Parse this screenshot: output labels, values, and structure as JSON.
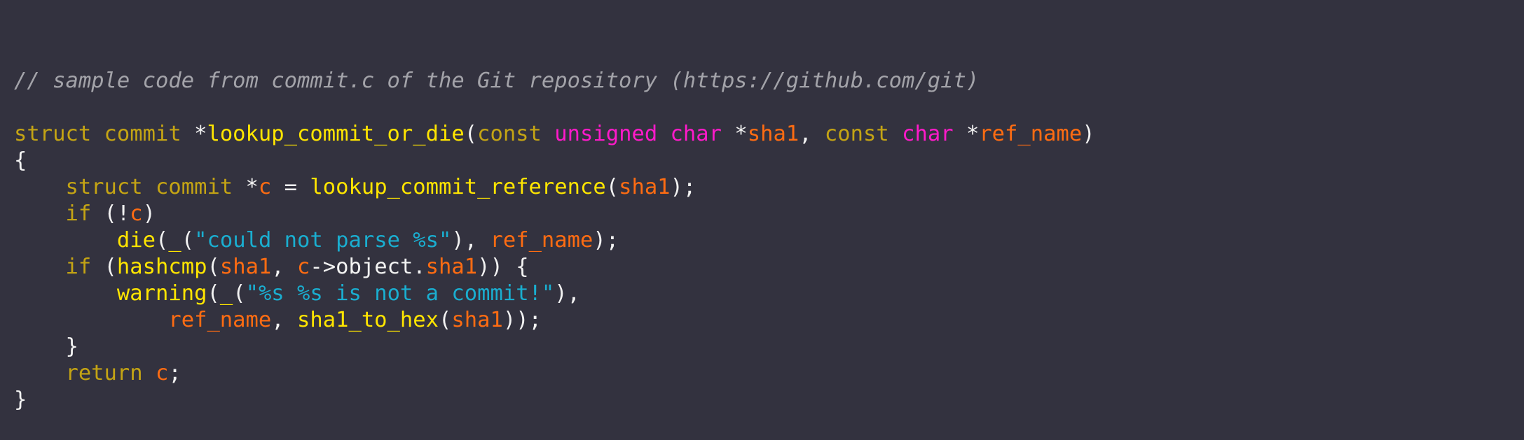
{
  "editor": {
    "background": "#33323f",
    "theme_colors": {
      "comment": "#a3a3a9",
      "keyword": "#c4a414",
      "type_modifier": "#ff1aca",
      "function": "#ffe500",
      "variable": "#ff6c12",
      "string": "#1aaed0",
      "plain": "#f2f2f2"
    },
    "lines": [
      [
        {
          "t": "// sample code from commit.c of the Git repository (https://github.com/git)",
          "k": "comment"
        }
      ],
      [],
      [
        {
          "t": "struct commit ",
          "k": "keyword"
        },
        {
          "t": "*",
          "k": "plain"
        },
        {
          "t": "lookup_commit_or_die",
          "k": "function"
        },
        {
          "t": "(",
          "k": "plain"
        },
        {
          "t": "const ",
          "k": "keyword"
        },
        {
          "t": "unsigned char ",
          "k": "type_modifier"
        },
        {
          "t": "*",
          "k": "plain"
        },
        {
          "t": "sha1",
          "k": "variable"
        },
        {
          "t": ", ",
          "k": "plain"
        },
        {
          "t": "const ",
          "k": "keyword"
        },
        {
          "t": "char ",
          "k": "type_modifier"
        },
        {
          "t": "*",
          "k": "plain"
        },
        {
          "t": "ref_name",
          "k": "variable"
        },
        {
          "t": ")",
          "k": "plain"
        }
      ],
      [
        {
          "t": "{",
          "k": "plain"
        }
      ],
      [
        {
          "t": "    ",
          "k": "plain"
        },
        {
          "t": "struct commit ",
          "k": "keyword"
        },
        {
          "t": "*",
          "k": "plain"
        },
        {
          "t": "c",
          "k": "variable"
        },
        {
          "t": " = ",
          "k": "plain"
        },
        {
          "t": "lookup_commit_reference",
          "k": "function"
        },
        {
          "t": "(",
          "k": "plain"
        },
        {
          "t": "sha1",
          "k": "variable"
        },
        {
          "t": ");",
          "k": "plain"
        }
      ],
      [
        {
          "t": "    ",
          "k": "plain"
        },
        {
          "t": "if",
          "k": "keyword"
        },
        {
          "t": " (!",
          "k": "plain"
        },
        {
          "t": "c",
          "k": "variable"
        },
        {
          "t": ")",
          "k": "plain"
        }
      ],
      [
        {
          "t": "        ",
          "k": "plain"
        },
        {
          "t": "die",
          "k": "function"
        },
        {
          "t": "(",
          "k": "plain"
        },
        {
          "t": "_",
          "k": "function"
        },
        {
          "t": "(",
          "k": "plain"
        },
        {
          "t": "\"could not parse %s\"",
          "k": "string"
        },
        {
          "t": "), ",
          "k": "plain"
        },
        {
          "t": "ref_name",
          "k": "variable"
        },
        {
          "t": ");",
          "k": "plain"
        }
      ],
      [
        {
          "t": "    ",
          "k": "plain"
        },
        {
          "t": "if",
          "k": "keyword"
        },
        {
          "t": " (",
          "k": "plain"
        },
        {
          "t": "hashcmp",
          "k": "function"
        },
        {
          "t": "(",
          "k": "plain"
        },
        {
          "t": "sha1",
          "k": "variable"
        },
        {
          "t": ", ",
          "k": "plain"
        },
        {
          "t": "c",
          "k": "variable"
        },
        {
          "t": "->object.",
          "k": "plain"
        },
        {
          "t": "sha1",
          "k": "variable"
        },
        {
          "t": ")) {",
          "k": "plain"
        }
      ],
      [
        {
          "t": "        ",
          "k": "plain"
        },
        {
          "t": "warning",
          "k": "function"
        },
        {
          "t": "(",
          "k": "plain"
        },
        {
          "t": "_",
          "k": "function"
        },
        {
          "t": "(",
          "k": "plain"
        },
        {
          "t": "\"%s %s is not a commit!\"",
          "k": "string"
        },
        {
          "t": "),",
          "k": "plain"
        }
      ],
      [
        {
          "t": "            ",
          "k": "plain"
        },
        {
          "t": "ref_name",
          "k": "variable"
        },
        {
          "t": ", ",
          "k": "plain"
        },
        {
          "t": "sha1_to_hex",
          "k": "function"
        },
        {
          "t": "(",
          "k": "plain"
        },
        {
          "t": "sha1",
          "k": "variable"
        },
        {
          "t": "));",
          "k": "plain"
        }
      ],
      [
        {
          "t": "    }",
          "k": "plain"
        }
      ],
      [
        {
          "t": "    ",
          "k": "plain"
        },
        {
          "t": "return",
          "k": "keyword"
        },
        {
          "t": " ",
          "k": "plain"
        },
        {
          "t": "c",
          "k": "variable"
        },
        {
          "t": ";",
          "k": "plain"
        }
      ],
      [
        {
          "t": "}",
          "k": "plain"
        }
      ]
    ]
  }
}
